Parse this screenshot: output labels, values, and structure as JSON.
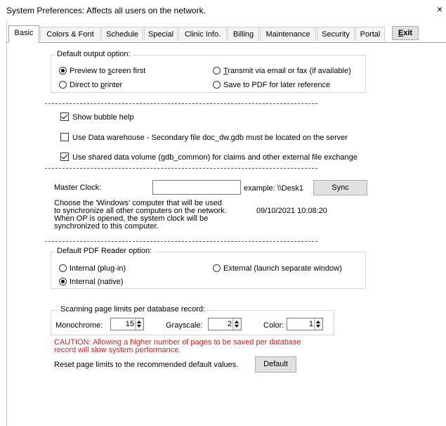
{
  "window": {
    "title": "System Preferences: Affects all users on the network.",
    "close_glyph": "×"
  },
  "tabs": [
    {
      "label": "Basic",
      "active": true
    },
    {
      "label": "Colors & Font",
      "active": false
    },
    {
      "label": "Schedule",
      "active": false
    },
    {
      "label": "Special",
      "active": false
    },
    {
      "label": "Clinic Info.",
      "active": false
    },
    {
      "label": "Billing",
      "active": false
    },
    {
      "label": "Maintenance",
      "active": false
    },
    {
      "label": "Security",
      "active": false
    },
    {
      "label": "Portal",
      "active": false
    }
  ],
  "exit_button": {
    "label_underlined": "E",
    "label_rest": "xit"
  },
  "output_option": {
    "legend": "Default output option:",
    "preview": {
      "before": "Preview to ",
      "accel": "s",
      "after": "creen first",
      "selected": true
    },
    "printer": {
      "before": "Direct to ",
      "accel": "p",
      "after": "rinter",
      "selected": false
    },
    "transmit": {
      "before": "",
      "accel": "T",
      "after": "ransmit via email or fax (if available)",
      "selected": false
    },
    "pdf": {
      "label": "Save to PDF for later reference",
      "selected": false
    }
  },
  "checkboxes": {
    "bubble_help": {
      "label": "Show bubble help",
      "checked": true
    },
    "data_warehouse": {
      "label": "Use Data warehouse - Secondary file doc_dw.gdb must be located on the server",
      "checked": false
    },
    "shared_volume": {
      "label": "Use shared data volume (gdb_common) for claims and other external file exchange",
      "checked": true
    }
  },
  "master_clock": {
    "label": "Master Clock:",
    "value": "",
    "example": "example:  \\\\Desk1",
    "sync_label": "Sync",
    "description": [
      "Choose the 'Windows' computer that will be used",
      "to synchronize all other computers on the network.",
      "When OP is opened,  the system clock will be",
      "synchronized to this computer."
    ],
    "timestamp": "09/10/2021 10:08:20"
  },
  "pdf_reader": {
    "legend": "Default PDF Reader option:",
    "plugin": {
      "label": "Internal (plug-in)",
      "selected": false
    },
    "external": {
      "label": "External (launch separate window)",
      "selected": false
    },
    "native": {
      "label": "Internal (native)",
      "selected": true
    }
  },
  "scanning": {
    "legend": "Scanning page limits per database record:",
    "mono_label": "Monochrome:",
    "mono_value": "15",
    "gray_label": "Grayscale:",
    "gray_value": "2",
    "color_label": "Color:",
    "color_value": "1",
    "caution_line1": "CAUTION: Allowing a higher number of pages to be saved per database",
    "caution_line2": "record will slow system performance.",
    "reset_text": "Reset page limits to the recommended default values.",
    "default_button": "Default"
  }
}
